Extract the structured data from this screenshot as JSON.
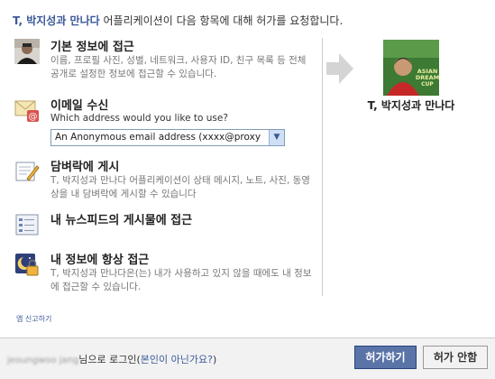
{
  "header": {
    "app_name": "T, 박지성과 만나다",
    "request_text": " 어플리케이션이 다음 항목에 대해 허가를 요청합니다."
  },
  "permissions": [
    {
      "icon": "user-photo-icon",
      "title": "기본 정보에 접근",
      "description": "이름, 프로필 사진, 성별, 네트워크, 사용자 ID, 친구 목록 등 전체 공개로 설정한 정보에 접근할 수 있습니다."
    },
    {
      "icon": "email-icon",
      "title": "이메일 수신",
      "subtitle": "Which address would you like to use?",
      "select_value": "An Anonymous email address (xxxx@proxy"
    },
    {
      "icon": "wall-post-icon",
      "title": "담벼락에 게시",
      "description": "T, 박지성과 만나다 어플리케이션이 상태 메시지, 노트, 사진, 동영상을 내 담벼락에 게시할 수 있습니다"
    },
    {
      "icon": "news-feed-icon",
      "title": "내 뉴스피드의 게시물에 접근"
    },
    {
      "icon": "offline-access-icon",
      "title": "내 정보에 항상 접근",
      "description": "T, 박지성과 만나다은(는) 내가 사용하고 있지 않을 때에도 내 정보에 접근할 수 있습니다."
    }
  ],
  "app_profile": {
    "name": "T, 박지성과 만나다",
    "picture_text": [
      "ASIAN",
      "DREAM",
      "CUP"
    ]
  },
  "report_link": "앱 신고하기",
  "footer": {
    "user_name": "jeoungwoo jang",
    "login_suffix": "님으로 로그인(",
    "not_you_link": "본인이 아닌가요?",
    "close_paren": ")",
    "allow_button": "허가하기",
    "deny_button": "허가 안함"
  },
  "colors": {
    "link": "#3b5998",
    "allow_button_bg": "#5b74a8"
  }
}
